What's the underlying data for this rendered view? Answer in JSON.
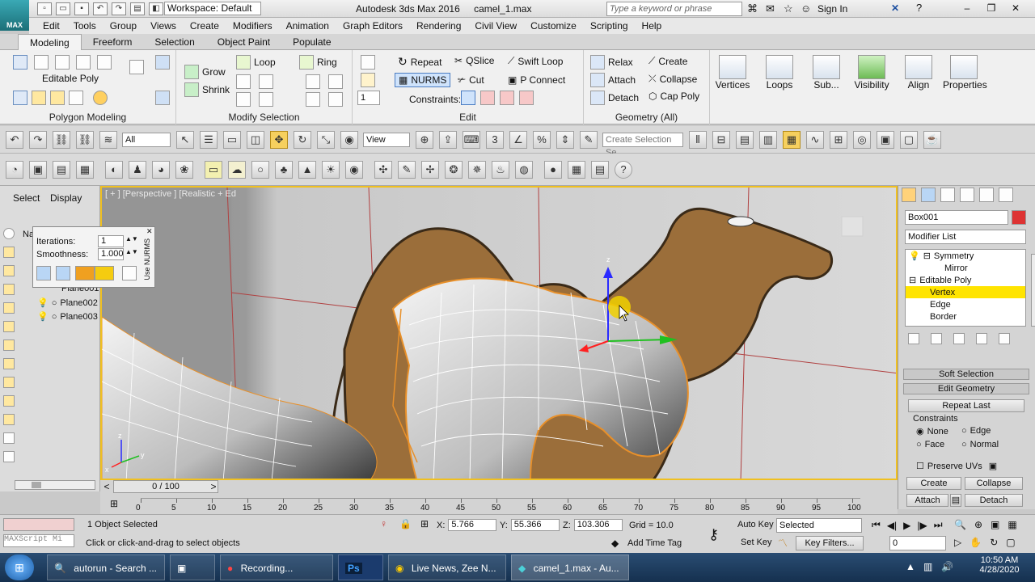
{
  "titlebar": {
    "logo": "MAX",
    "workspace": "Workspace: Default",
    "app_title": "Autodesk 3ds Max 2016",
    "file_name": "camel_1.max",
    "search_placeholder": "Type a keyword or phrase",
    "sign_in": "Sign In"
  },
  "menu": [
    "Edit",
    "Tools",
    "Group",
    "Views",
    "Create",
    "Modifiers",
    "Animation",
    "Graph Editors",
    "Rendering",
    "Civil View",
    "Customize",
    "Scripting",
    "Help"
  ],
  "ribbon_tabs": [
    "Modeling",
    "Freeform",
    "Selection",
    "Object Paint",
    "Populate"
  ],
  "ribbon": {
    "polygon_modeling": {
      "title": "Polygon Modeling",
      "label": "Editable Poly"
    },
    "modify_selection": {
      "title": "Modify Selection",
      "grow": "Grow",
      "shrink": "Shrink",
      "loop": "Loop",
      "ring": "Ring"
    },
    "edit": {
      "title": "Edit",
      "spinner": "1",
      "repeat": "Repeat",
      "qslice": "QSlice",
      "swift_loop": "Swift Loop",
      "nurms": "NURMS",
      "cut": "Cut",
      "p_connect": "P Connect",
      "constraints": "Constraints:"
    },
    "geometry": {
      "title": "Geometry (All)",
      "relax": "Relax",
      "create": "Create",
      "attach": "Attach",
      "collapse": "Collapse",
      "detach": "Detach",
      "cap_poly": "Cap Poly"
    },
    "big_buttons": [
      "Vertices",
      "Loops",
      "Sub...",
      "Visibility",
      "Align",
      "Properties"
    ]
  },
  "toolbar": {
    "filter": "All",
    "ref_coord": "View",
    "selection_set": "Create Selection Se"
  },
  "left_panel": {
    "tabs": [
      "Select",
      "Display"
    ],
    "items": [
      "Plane001",
      "Plane002",
      "Plane003"
    ],
    "na": "Na"
  },
  "popup": {
    "iterations_label": "Iterations:",
    "iterations": "1",
    "smoothness_label": "Smoothness:",
    "smoothness": "1.000",
    "use_nurms": "Use NURMS"
  },
  "viewport": {
    "label": "[ + ] [Perspective ] [Realistic + Ed",
    "axis_x": "x",
    "axis_y": "y",
    "axis_z": "z",
    "gizmo_z": "z"
  },
  "command_panel": {
    "object_name": "Box001",
    "modifier_list": "Modifier List",
    "stack": [
      {
        "label": "Symmetry",
        "level": 0
      },
      {
        "label": "Mirror",
        "level": 1
      },
      {
        "label": "Editable Poly",
        "level": 0
      },
      {
        "label": "Vertex",
        "level": 1,
        "selected": true
      },
      {
        "label": "Edge",
        "level": 1
      },
      {
        "label": "Border",
        "level": 1
      }
    ],
    "soft_selection": "Soft Selection",
    "edit_geometry": "Edit Geometry",
    "repeat_last": "Repeat Last",
    "constraints": "Constraints",
    "none": "None",
    "edge": "Edge",
    "face": "Face",
    "normal": "Normal",
    "preserve_uvs": "Preserve UVs",
    "create": "Create",
    "collapse": "Collapse",
    "attach": "Attach",
    "detach": "Detach"
  },
  "timeline": {
    "slider": "0 / 100",
    "ticks": [
      "0",
      "5",
      "10",
      "15",
      "20",
      "25",
      "30",
      "35",
      "40",
      "45",
      "50",
      "55",
      "60",
      "65",
      "70",
      "75",
      "80",
      "85",
      "90",
      "95",
      "100"
    ]
  },
  "status": {
    "selected": "1 Object Selected",
    "prompt": "Click or click-and-drag to select objects",
    "maxscript": "MAXScript Mi",
    "x_label": "X:",
    "x": "5.766",
    "y_label": "Y:",
    "y": "55.366",
    "z_label": "Z:",
    "z": "103.306",
    "grid": "Grid = 10.0",
    "add_time_tag": "Add Time Tag",
    "auto_key": "Auto Key",
    "set_key": "Set Key",
    "selected_dd": "Selected",
    "key_filters": "Key Filters...",
    "frame": "0"
  },
  "taskbar": {
    "tasks": [
      "autorun - Search ...",
      "",
      "Recording...",
      "",
      "Live News, Zee N...",
      "camel_1.max - Au..."
    ],
    "time": "10:50 AM",
    "date": "4/28/2020"
  },
  "colors": {
    "accent": "#f0c020",
    "selected": "#ffe400",
    "orange": "#f0a020",
    "mesh_edge": "#e8902a"
  }
}
